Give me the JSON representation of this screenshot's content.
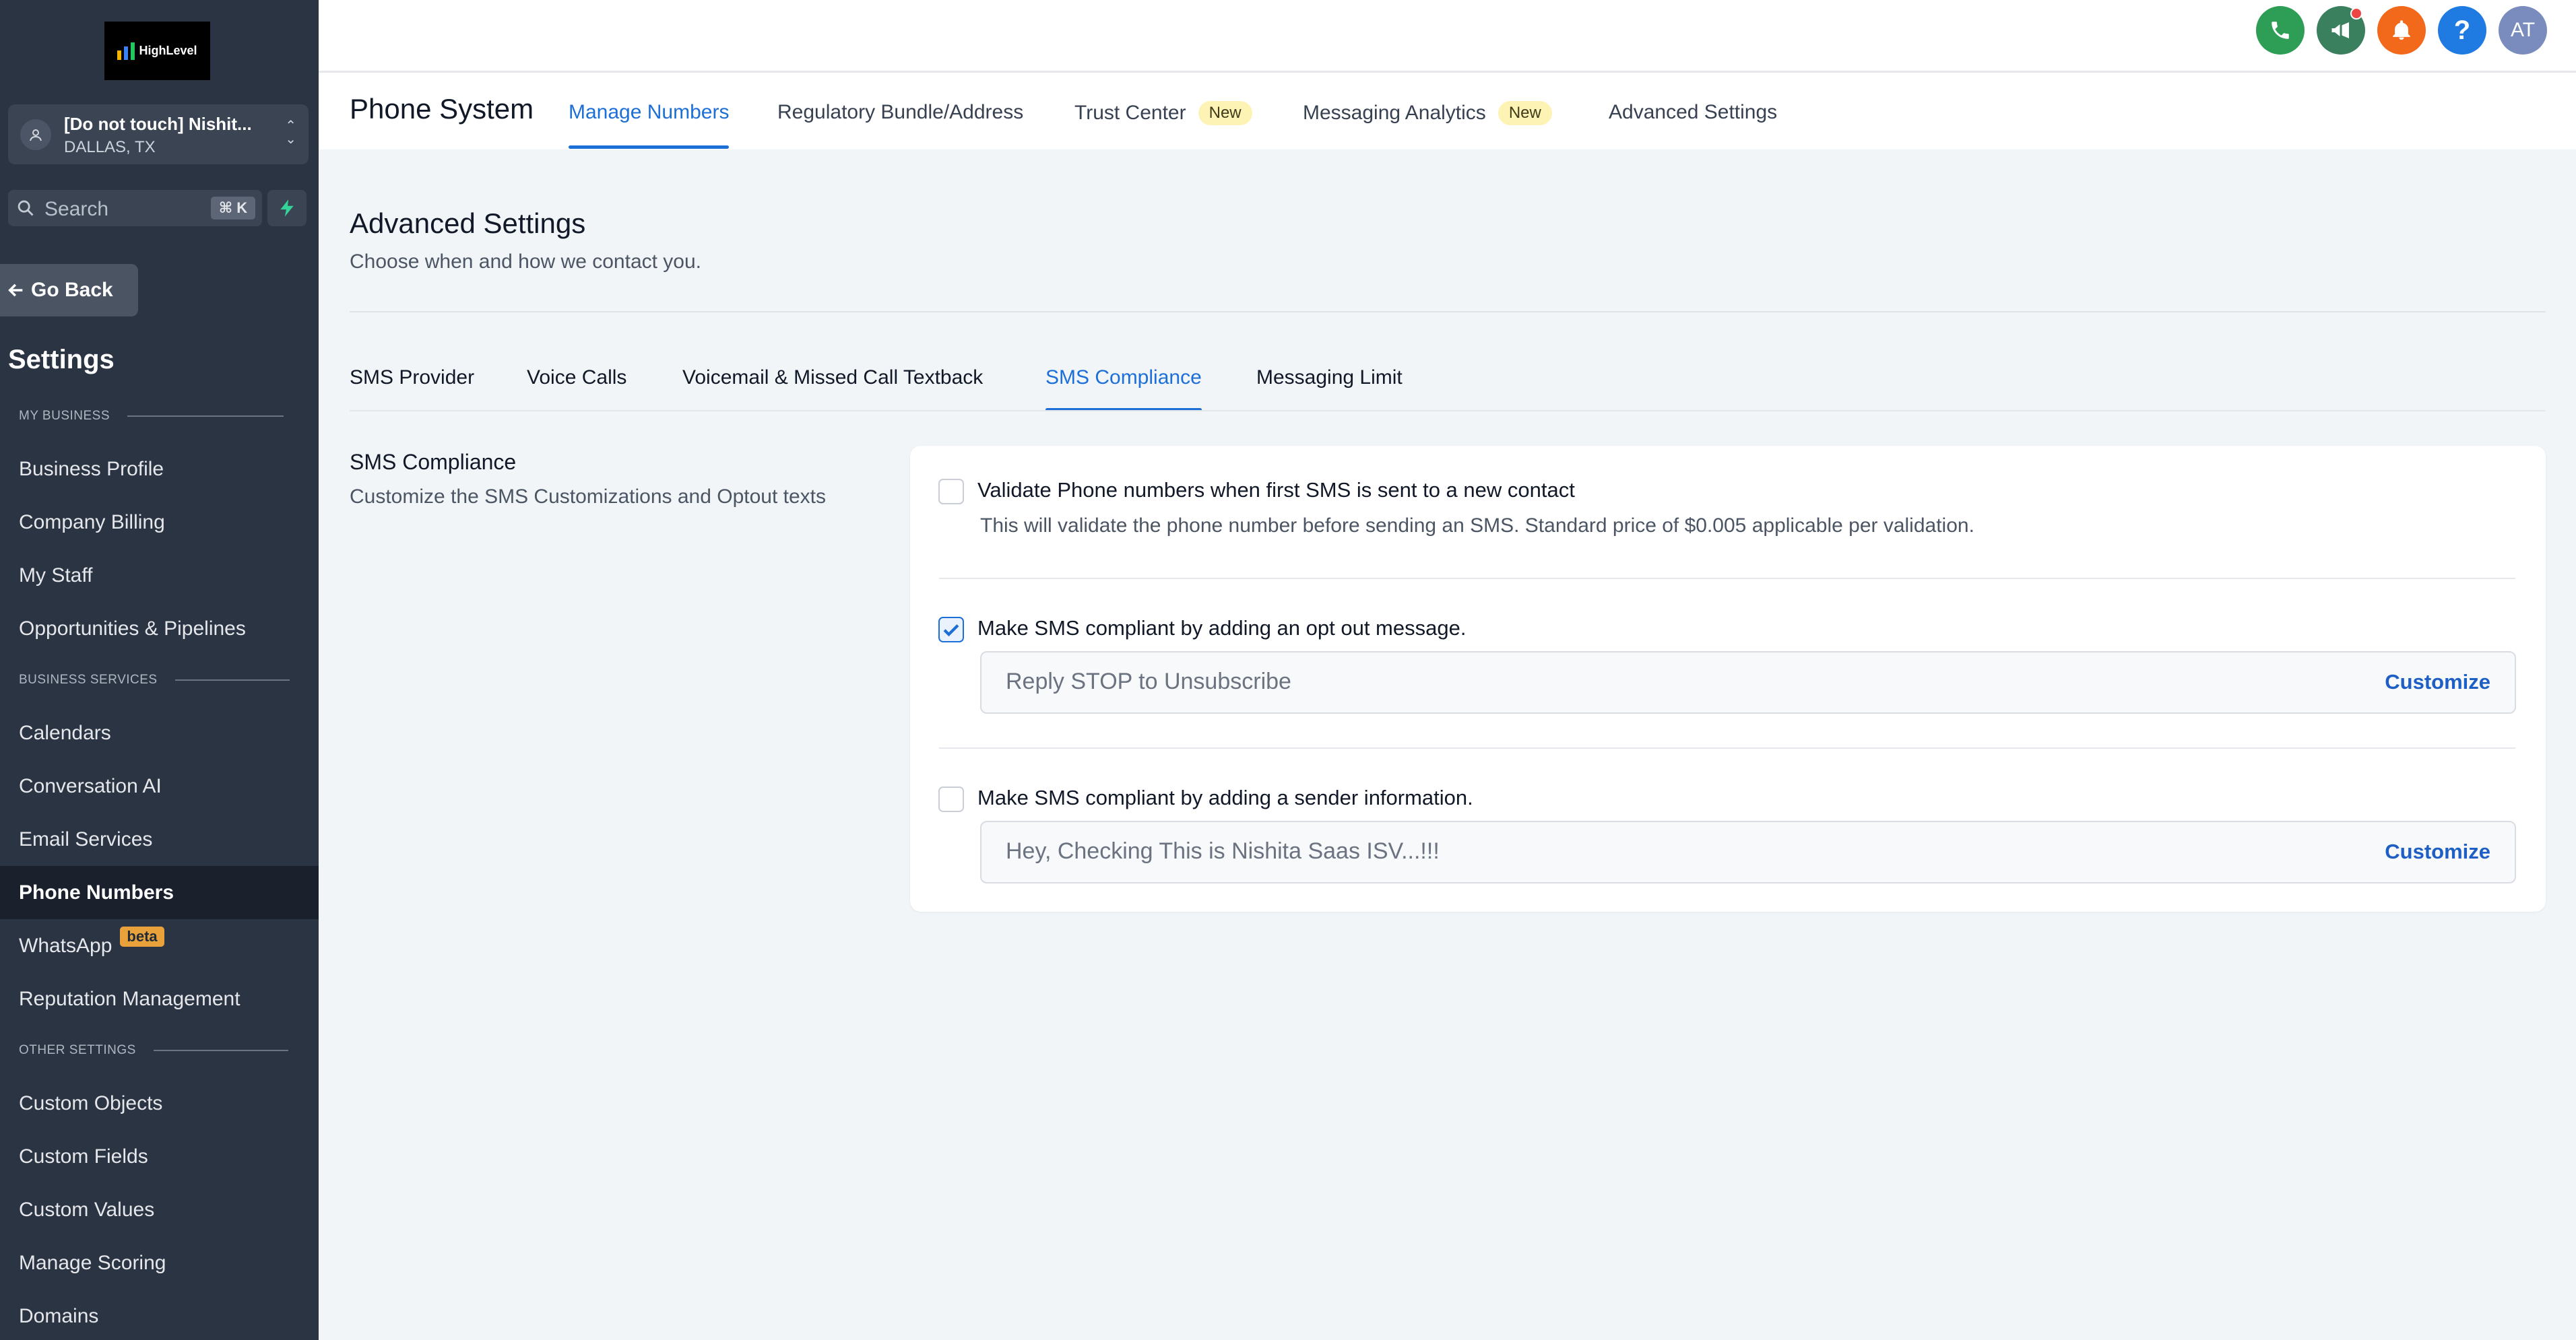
{
  "app": {
    "logo_text": "HighLevel",
    "location_name": "[Do not touch] Nishit...",
    "location_city": "DALLAS, TX",
    "search_placeholder": "Search",
    "search_shortcut": "⌘ K",
    "go_back_label": "Go Back",
    "settings_title": "Settings"
  },
  "sidebar": {
    "sections": [
      {
        "label": "MY BUSINESS"
      },
      {
        "label": "BUSINESS SERVICES"
      },
      {
        "label": "OTHER SETTINGS"
      }
    ],
    "items": [
      {
        "label": "Business Profile"
      },
      {
        "label": "Company Billing"
      },
      {
        "label": "My Staff"
      },
      {
        "label": "Opportunities & Pipelines"
      },
      {
        "label": "Calendars"
      },
      {
        "label": "Conversation AI"
      },
      {
        "label": "Email Services"
      },
      {
        "label": "Phone Numbers",
        "active": true
      },
      {
        "label": "WhatsApp",
        "badge": "beta"
      },
      {
        "label": "Reputation Management"
      },
      {
        "label": "Custom Objects"
      },
      {
        "label": "Custom Fields"
      },
      {
        "label": "Custom Values"
      },
      {
        "label": "Manage Scoring"
      },
      {
        "label": "Domains"
      }
    ]
  },
  "topbar": {
    "avatar_initials": "AT",
    "icons": [
      "phone-icon",
      "megaphone-icon",
      "bell-icon",
      "help-icon"
    ],
    "colors": {
      "phone": "#2e9d55",
      "megaphone": "#3a7f5e",
      "bell": "#f2691c",
      "help": "#1f7be2",
      "avatar": "#7a8bbd"
    }
  },
  "subheader": {
    "title": "Phone System",
    "tabs": [
      {
        "label": "Manage Numbers",
        "active": true
      },
      {
        "label": "Regulatory Bundle/Address"
      },
      {
        "label": "Trust Center",
        "badge": "New"
      },
      {
        "label": "Messaging Analytics",
        "badge": "New"
      },
      {
        "label": "Advanced Settings"
      }
    ]
  },
  "content": {
    "title": "Advanced Settings",
    "subtitle": "Choose when and how we contact you.",
    "tabs": [
      {
        "label": "SMS Provider"
      },
      {
        "label": "Voice Calls"
      },
      {
        "label": "Voicemail & Missed Call Textback"
      },
      {
        "label": "SMS Compliance",
        "active": true
      },
      {
        "label": "Messaging Limit"
      }
    ],
    "section_title": "SMS Compliance",
    "section_desc": "Customize the SMS Customizations and Optout texts",
    "options": [
      {
        "label": "Validate Phone numbers when first SMS is sent to a new contact",
        "help": "This will validate the phone number before sending an SMS. Standard price of $0.005 applicable per validation.",
        "checked": false
      },
      {
        "label": "Make SMS compliant by adding an opt out message.",
        "value": "Reply STOP to Unsubscribe",
        "action": "Customize",
        "checked": true
      },
      {
        "label": "Make SMS compliant by adding a sender information.",
        "value": "Hey, Checking This is Nishita Saas ISV...!!!",
        "action": "Customize",
        "checked": false
      }
    ]
  },
  "accent_color": "#1d6fd8"
}
